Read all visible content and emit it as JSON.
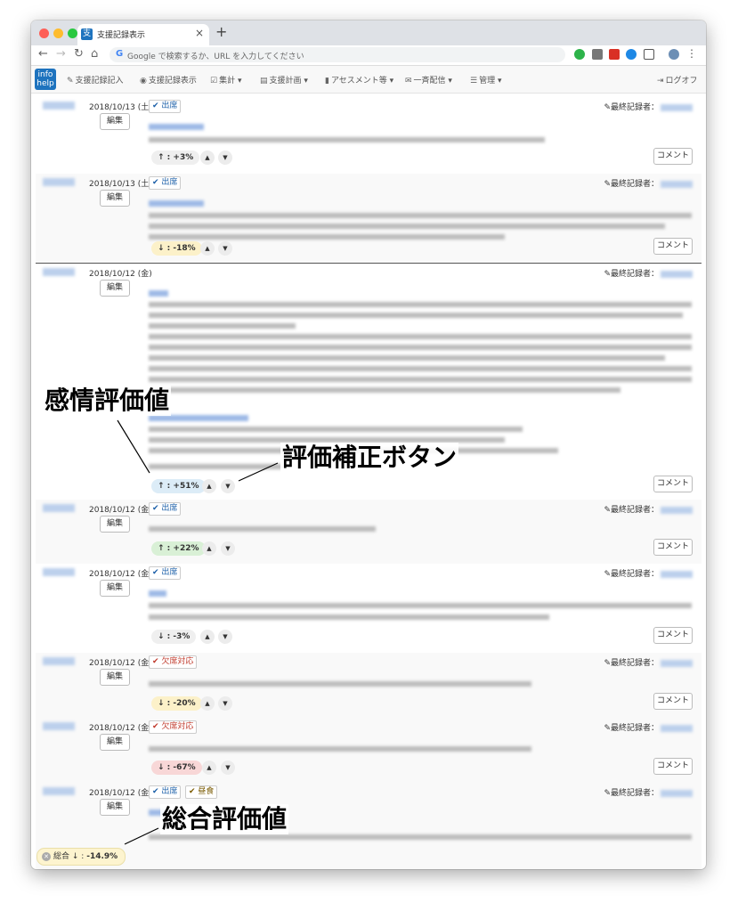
{
  "browser": {
    "tab_title": "支援記録表示",
    "tab_icon_text": "支",
    "tab_close": "×",
    "new_tab": "+",
    "omnibox_placeholder": "Google で検索するか、URL を入力してください"
  },
  "app": {
    "logo": "info help",
    "menu": [
      {
        "label": "支援記録記入",
        "icon": "pencil-icon"
      },
      {
        "label": "支援記録表示",
        "icon": "eye-icon"
      },
      {
        "label": "集計",
        "icon": "check-icon",
        "dropdown": true
      },
      {
        "label": "支援計画",
        "icon": "calendar-icon",
        "dropdown": true
      },
      {
        "label": "アセスメント等",
        "icon": "document-icon",
        "dropdown": true
      },
      {
        "label": "一斉配信",
        "icon": "mail-icon",
        "dropdown": true
      },
      {
        "label": "管理",
        "icon": "list-icon",
        "dropdown": true
      }
    ],
    "logout": "ログオフ"
  },
  "labels": {
    "edit": "編集",
    "comment": "コメント",
    "recorder": "最終記録者：",
    "up": "▲",
    "down": "▼"
  },
  "records": [
    {
      "date": "2018/10/13 (土)",
      "badges": [
        {
          "text": "出席",
          "type": "blue"
        }
      ],
      "score": "+3%",
      "dir": "↑",
      "tone": "neutral"
    },
    {
      "date": "2018/10/13 (土)",
      "badges": [
        {
          "text": "出席",
          "type": "blue"
        }
      ],
      "score": "-18%",
      "dir": "↓",
      "tone": "yellow"
    },
    {
      "date": "2018/10/12 (金)",
      "badges": [],
      "score": "+51%",
      "dir": "↑",
      "tone": "blue"
    },
    {
      "date": "2018/10/12 (金)",
      "badges": [
        {
          "text": "出席",
          "type": "blue"
        }
      ],
      "score": "+22%",
      "dir": "↑",
      "tone": "green"
    },
    {
      "date": "2018/10/12 (金)",
      "badges": [
        {
          "text": "出席",
          "type": "blue"
        }
      ],
      "score": "-3%",
      "dir": "↓",
      "tone": "neutral"
    },
    {
      "date": "2018/10/12 (金)",
      "badges": [
        {
          "text": "欠席対応",
          "type": "red"
        }
      ],
      "score": "-20%",
      "dir": "↓",
      "tone": "yellow"
    },
    {
      "date": "2018/10/12 (金)",
      "badges": [
        {
          "text": "欠席対応",
          "type": "red"
        }
      ],
      "score": "-67%",
      "dir": "↓",
      "tone": "red"
    },
    {
      "date": "2018/10/12 (金)",
      "badges": [
        {
          "text": "出席",
          "type": "blue"
        },
        {
          "text": "昼食",
          "type": "brown"
        }
      ],
      "score": null,
      "dir": null,
      "tone": null
    }
  ],
  "total": {
    "label": "総合",
    "dir": "↓",
    "value": "-14.9%"
  },
  "annotations": {
    "emotion_value": "感情評価値",
    "correction_buttons": "評価補正ボタン",
    "total_value": "総合評価値"
  }
}
